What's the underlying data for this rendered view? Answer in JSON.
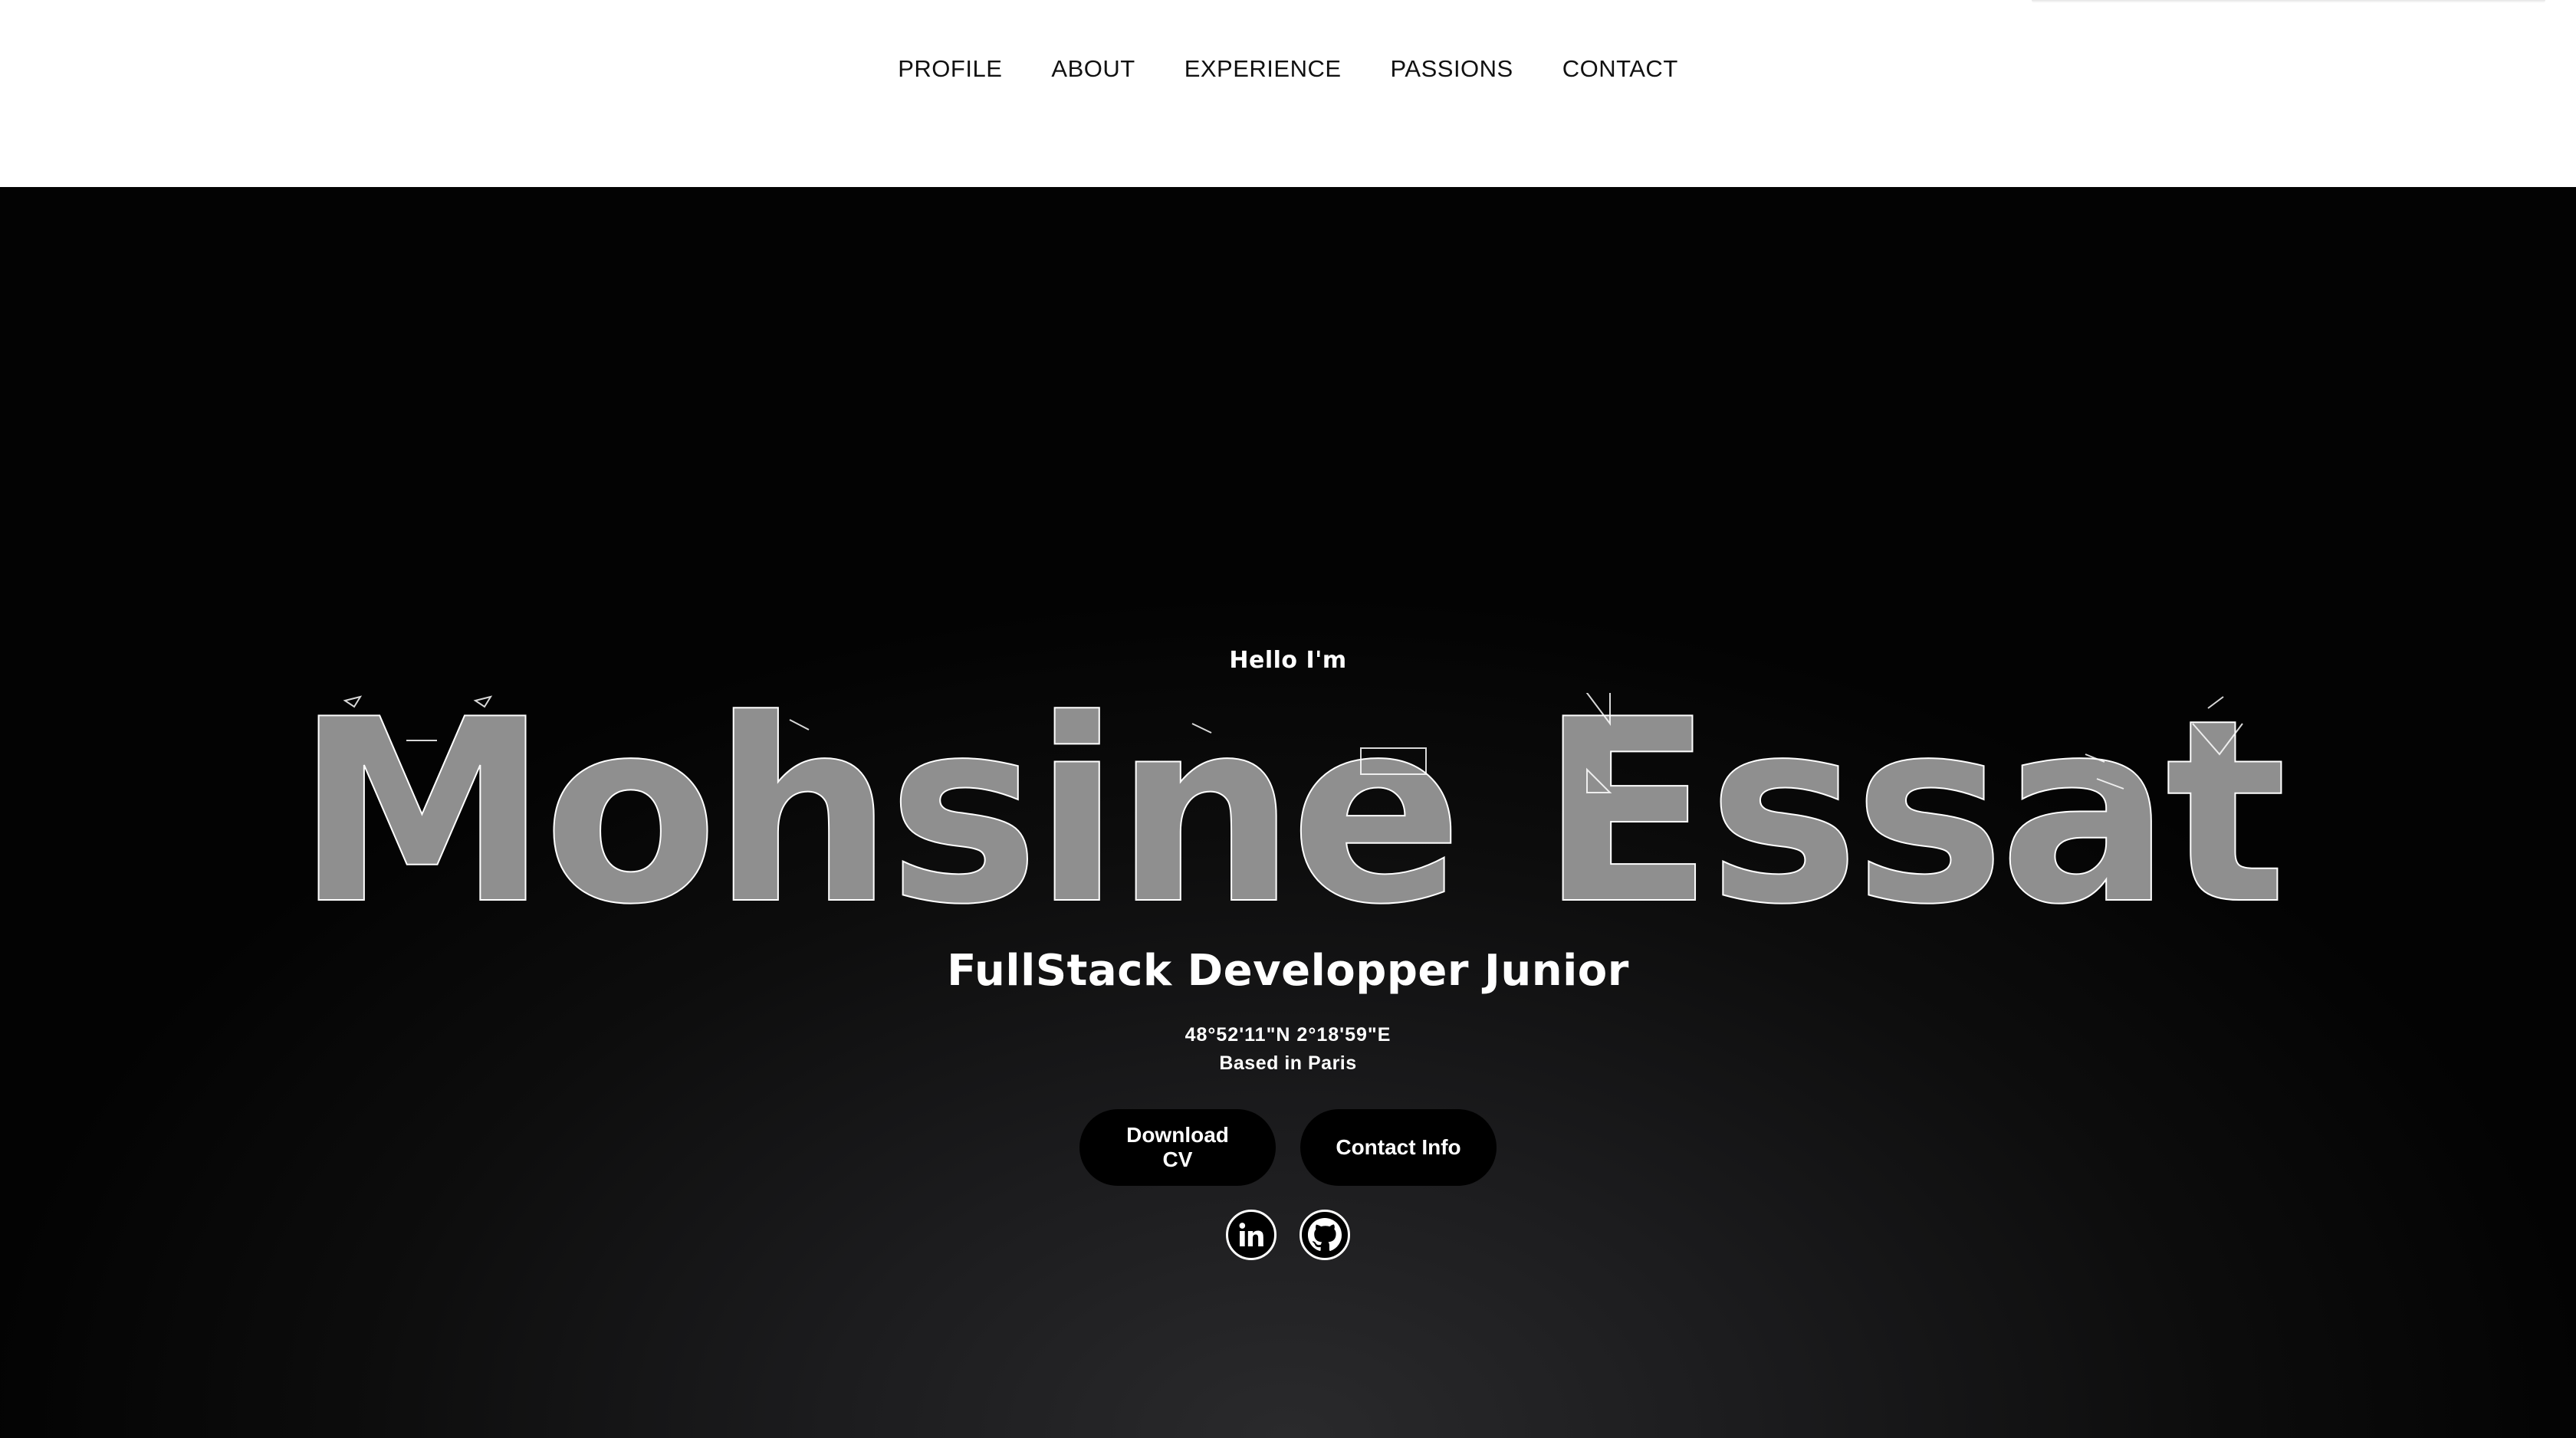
{
  "nav": {
    "items": [
      {
        "label": "PROFILE"
      },
      {
        "label": "ABOUT"
      },
      {
        "label": "EXPERIENCE"
      },
      {
        "label": "PASSIONS"
      },
      {
        "label": "CONTACT"
      }
    ]
  },
  "hero": {
    "greeting": "Hello I'm",
    "name": "Mohsine Essat",
    "role": "FullStack Developper Junior",
    "coordinates": "48°52'11\"N 2°18'59\"E",
    "location": "Based in Paris",
    "buttons": {
      "download_cv": "Download CV",
      "contact_info": "Contact Info"
    },
    "socials": [
      {
        "icon": "linkedin-icon"
      },
      {
        "icon": "github-icon"
      }
    ]
  },
  "colors": {
    "nav_bg": "#ffffff",
    "hero_bg": "#0d0d0d",
    "name_fill": "#8f8f8f",
    "name_stroke": "#ffffff",
    "button_bg": "#000000",
    "text": "#ffffff"
  }
}
